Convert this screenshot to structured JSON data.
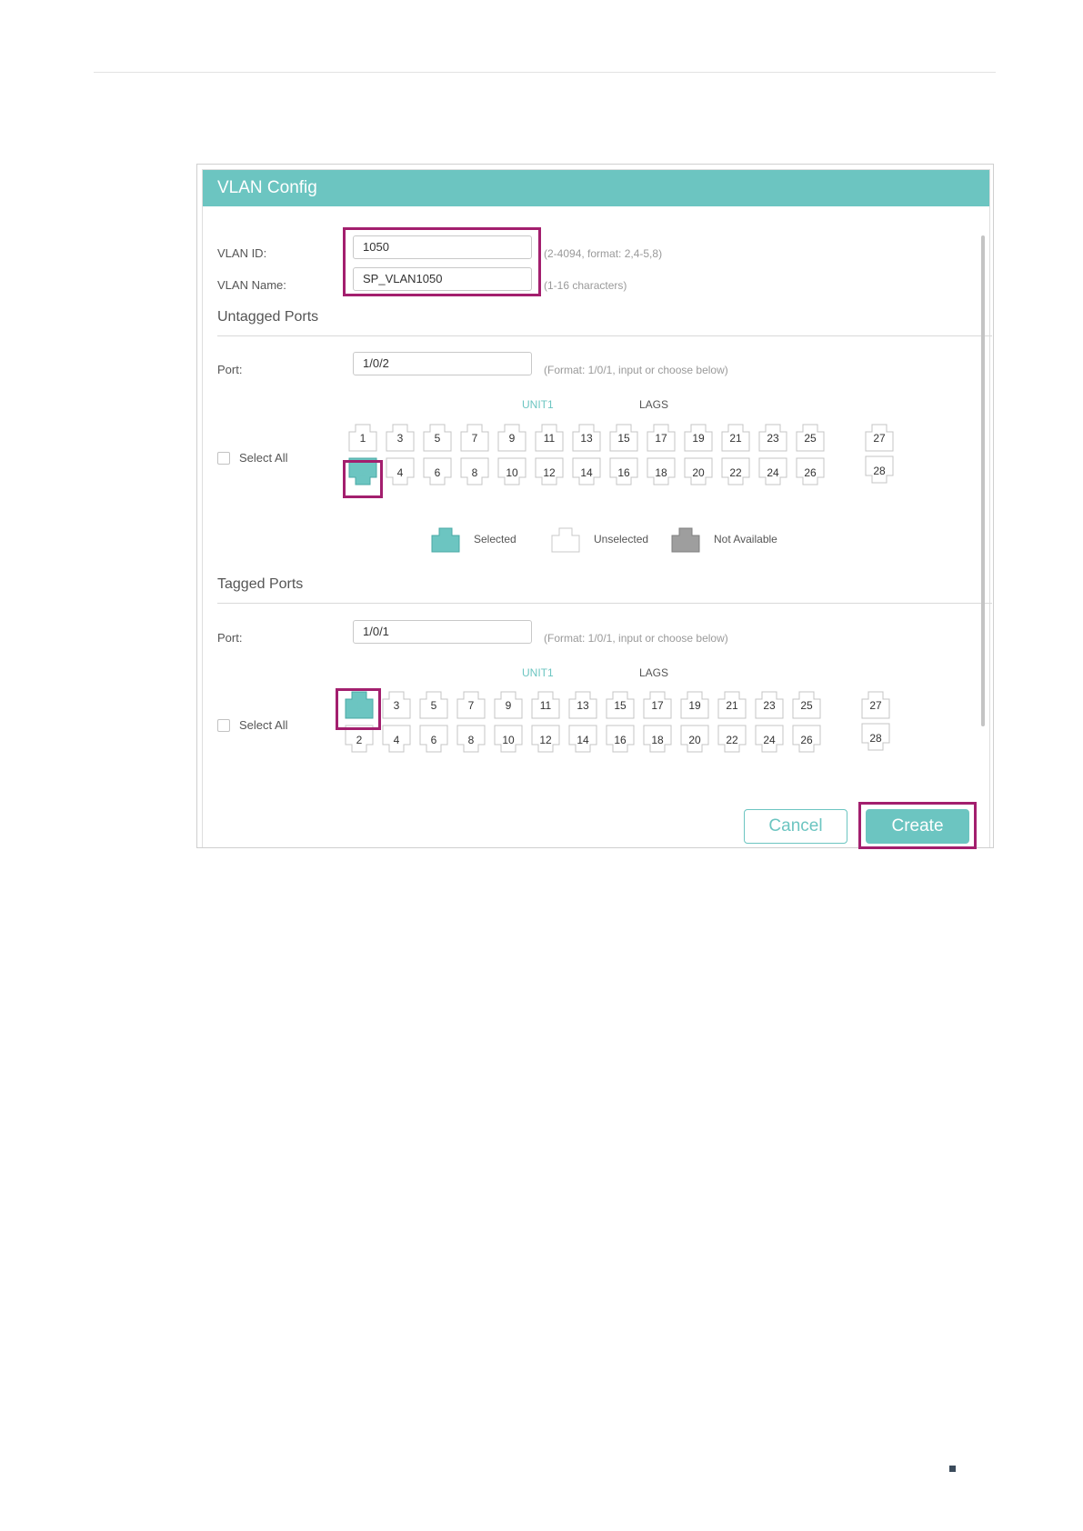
{
  "dialog": {
    "title": "VLAN Config"
  },
  "form": {
    "vlan_id": {
      "label": "VLAN ID:",
      "value": "1050",
      "hint": "(2-4094, format: 2,4-5,8)"
    },
    "vlan_name": {
      "label": "VLAN Name:",
      "value": "SP_VLAN1050",
      "hint": "(1-16 characters)"
    }
  },
  "untagged": {
    "title": "Untagged Ports",
    "port_label": "Port:",
    "port_value": "1/0/2",
    "port_hint": "(Format: 1/0/1, input or choose below)",
    "unit_label": "UNIT1",
    "lags_label": "LAGS",
    "select_all": "Select All",
    "selected_ports": [
      "2"
    ]
  },
  "tagged": {
    "title": "Tagged Ports",
    "port_label": "Port:",
    "port_value": "1/0/1",
    "port_hint": "(Format: 1/0/1, input or choose below)",
    "unit_label": "UNIT1",
    "lags_label": "LAGS",
    "select_all": "Select All",
    "selected_ports": [
      "1"
    ]
  },
  "ports": {
    "top_row": [
      "1",
      "3",
      "5",
      "7",
      "9",
      "11",
      "13",
      "15",
      "17",
      "19",
      "21",
      "23",
      "25"
    ],
    "bottom_row": [
      "2",
      "4",
      "6",
      "8",
      "10",
      "12",
      "14",
      "16",
      "18",
      "20",
      "22",
      "24",
      "26"
    ],
    "extra_top": "27",
    "extra_bottom": "28"
  },
  "legend": {
    "selected": "Selected",
    "unselected": "Unselected",
    "not_available": "Not Available"
  },
  "buttons": {
    "cancel": "Cancel",
    "create": "Create"
  },
  "colors": {
    "accent": "#6cc5c1",
    "highlight": "#a31f6e",
    "not_available": "#9e9e9e"
  }
}
